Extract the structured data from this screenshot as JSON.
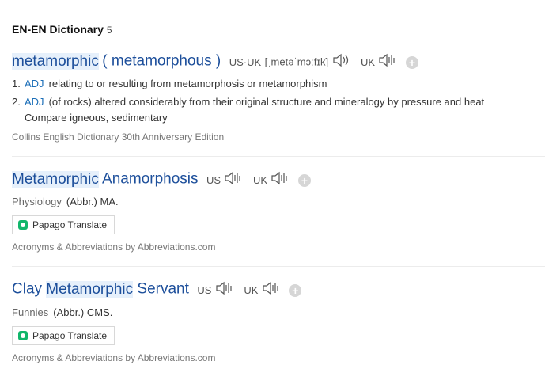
{
  "header": {
    "title": "EN-EN Dictionary",
    "count": "5"
  },
  "entry1": {
    "word": "metamorphic",
    "alt": "( metamorphous )",
    "us_uk_label": "US·UK",
    "ipa": "[ˌmetəˈmɔːfɪk]",
    "uk_label": "UK",
    "defs": [
      {
        "num": "1.",
        "pos": "ADJ",
        "text": "relating to or resulting from metamorphosis or metamorphism"
      },
      {
        "num": "2.",
        "pos": "ADJ",
        "text": "(of rocks) altered considerably from their original structure and mineralogy by pressure and heat",
        "extra": "Compare igneous, sedimentary"
      }
    ],
    "source": "Collins English Dictionary 30th Anniversary Edition"
  },
  "entry2": {
    "word_hl": "Metamorphic",
    "word_rest": " Anamorphosis",
    "us_label": "US",
    "uk_label": "UK",
    "category": "Physiology",
    "abbr": "(Abbr.) MA.",
    "papago": "Papago Translate",
    "source": "Acronyms & Abbreviations by Abbreviations.com"
  },
  "entry3": {
    "word_pre": "Clay ",
    "word_hl": "Metamorphic",
    "word_rest": " Servant",
    "us_label": "US",
    "uk_label": "UK",
    "category": "Funnies",
    "abbr": "(Abbr.) CMS.",
    "papago": "Papago Translate",
    "source": "Acronyms & Abbreviations by Abbreviations.com"
  }
}
